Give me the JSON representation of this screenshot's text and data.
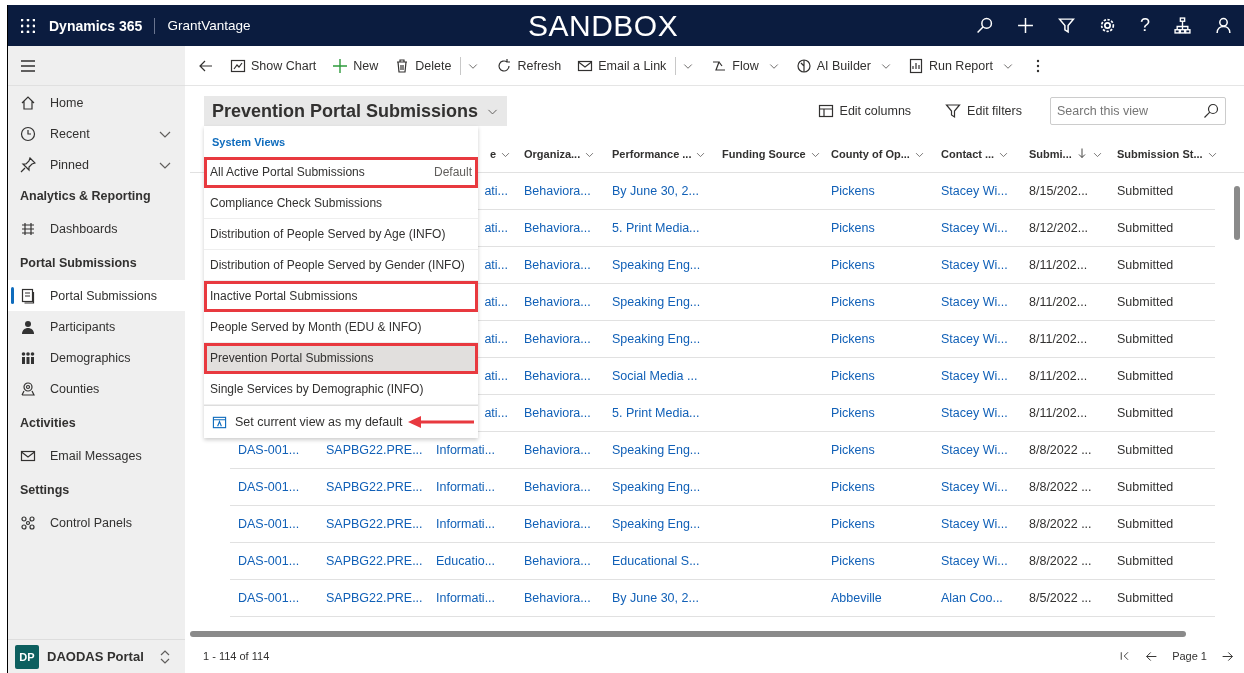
{
  "top_bar": {
    "app_name": "Dynamics 365",
    "org_name": "GrantVantage",
    "environment": "SANDBOX",
    "help_label": "?"
  },
  "toolbar": {
    "items": [
      {
        "kind": "icon"
      },
      {
        "kind": "button",
        "label": "Show Chart"
      },
      {
        "kind": "button",
        "label": "New"
      },
      {
        "kind": "button",
        "label": "Delete"
      },
      {
        "kind": "split"
      },
      {
        "kind": "button",
        "label": "Refresh"
      },
      {
        "kind": "button",
        "label": "Email a Link"
      },
      {
        "kind": "split"
      },
      {
        "kind": "menu",
        "label": "Flow"
      },
      {
        "kind": "menu",
        "label": "AI Builder"
      },
      {
        "kind": "menu",
        "label": "Run Report"
      },
      {
        "kind": "icon"
      }
    ]
  },
  "sidebar": {
    "items": [
      {
        "kind": "item",
        "label": "Home",
        "selected": false
      },
      {
        "kind": "expandable",
        "label": "Recent",
        "selected": false
      },
      {
        "kind": "expandable",
        "label": "Pinned",
        "selected": false
      },
      {
        "kind": "heading",
        "label": "Analytics & Reporting"
      },
      {
        "kind": "item",
        "label": "Dashboards",
        "selected": false
      },
      {
        "kind": "heading",
        "label": "Portal Submissions"
      },
      {
        "kind": "item",
        "label": "Portal Submissions",
        "selected": true
      },
      {
        "kind": "item",
        "label": "Participants",
        "selected": false
      },
      {
        "kind": "item",
        "label": "Demographics",
        "selected": false
      },
      {
        "kind": "item",
        "label": "Counties",
        "selected": false
      },
      {
        "kind": "heading",
        "label": "Activities"
      },
      {
        "kind": "item",
        "label": "Email Messages",
        "selected": false
      },
      {
        "kind": "heading",
        "label": "Settings"
      },
      {
        "kind": "item",
        "label": "Control Panels",
        "selected": false
      }
    ],
    "area_switcher": {
      "initials": "DP",
      "label": "DAODAS Portal"
    }
  },
  "view_selector": {
    "title": "Prevention Portal Submissions",
    "expanded": true,
    "menu": {
      "group": "System Views",
      "items": [
        {
          "label": "All Active Portal Submissions",
          "badge": "Default",
          "selected": false,
          "outlined": true
        },
        {
          "label": "Compliance Check Submissions",
          "selected": false,
          "outlined": false
        },
        {
          "label": "Distribution of People Served by Age (INFO)",
          "selected": false,
          "outlined": false
        },
        {
          "label": "Distribution of People Served by Gender (INFO)",
          "selected": false,
          "outlined": false
        },
        {
          "label": "Inactive Portal Submissions",
          "selected": false,
          "outlined": true
        },
        {
          "label": "People Served by Month (EDU & INFO)",
          "selected": false,
          "outlined": false
        },
        {
          "label": "Prevention Portal Submissions",
          "selected": true,
          "outlined": true
        },
        {
          "label": "Single Services by Demographic (INFO)",
          "selected": false,
          "outlined": false
        }
      ],
      "action": {
        "label": "Set current view as my default",
        "arrow_annotation": true
      }
    }
  },
  "view_actions": {
    "edit_columns": "Edit columns",
    "edit_filters": "Edit filters",
    "search": {
      "placeholder": "Search this view"
    }
  },
  "table": {
    "columns": [
      {
        "kind": "link"
      },
      {
        "kind": "link"
      },
      {
        "label": "e",
        "kind": "link",
        "sort_descending": false
      },
      {
        "label": "Organiza...",
        "kind": "link",
        "sort_descending": false
      },
      {
        "label": "Performance ...",
        "kind": "link",
        "sort_descending": false
      },
      {
        "label": "Funding Source",
        "sort_descending": false
      },
      {
        "label": "County of Op...",
        "kind": "link",
        "sort_descending": false
      },
      {
        "label": "Contact ...",
        "kind": "link",
        "sort_descending": false
      },
      {
        "label": "Submi...",
        "kind": "text",
        "sort_descending": true
      },
      {
        "label": "Submission St...",
        "kind": "text",
        "sort_descending": false
      }
    ],
    "rows": [
      {
        "cells": [
          "",
          "",
          "ati...",
          "Behaviora...",
          "By June 30, 2...",
          "",
          "Pickens",
          "Stacey Wi...",
          "8/15/202...",
          "Submitted"
        ]
      },
      {
        "cells": [
          "",
          "",
          "ati...",
          "Behaviora...",
          "5. Print Media...",
          "",
          "Pickens",
          "Stacey Wi...",
          "8/12/202...",
          "Submitted"
        ]
      },
      {
        "cells": [
          "",
          "",
          "ati...",
          "Behaviora...",
          "Speaking Eng...",
          "",
          "Pickens",
          "Stacey Wi...",
          "8/11/202...",
          "Submitted"
        ]
      },
      {
        "cells": [
          "",
          "",
          "ati...",
          "Behaviora...",
          "Speaking Eng...",
          "",
          "Pickens",
          "Stacey Wi...",
          "8/11/202...",
          "Submitted"
        ]
      },
      {
        "cells": [
          "",
          "",
          "ati...",
          "Behaviora...",
          "Speaking Eng...",
          "",
          "Pickens",
          "Stacey Wi...",
          "8/11/202...",
          "Submitted"
        ]
      },
      {
        "cells": [
          "",
          "",
          "ati...",
          "Behaviora...",
          "Social Media ...",
          "",
          "Pickens",
          "Stacey Wi...",
          "8/11/202...",
          "Submitted"
        ]
      },
      {
        "cells": [
          "",
          "",
          "ati...",
          "Behaviora...",
          "5. Print Media...",
          "",
          "Pickens",
          "Stacey Wi...",
          "8/11/202...",
          "Submitted"
        ]
      },
      {
        "cells": [
          "DAS-001...",
          "SAPBG22.PRE...",
          "Informati...",
          "Behaviora...",
          "Speaking Eng...",
          "",
          "Pickens",
          "Stacey Wi...",
          "8/8/2022 ...",
          "Submitted"
        ]
      },
      {
        "cells": [
          "DAS-001...",
          "SAPBG22.PRE...",
          "Informati...",
          "Behaviora...",
          "Speaking Eng...",
          "",
          "Pickens",
          "Stacey Wi...",
          "8/8/2022 ...",
          "Submitted"
        ]
      },
      {
        "cells": [
          "DAS-001...",
          "SAPBG22.PRE...",
          "Informati...",
          "Behaviora...",
          "Speaking Eng...",
          "",
          "Pickens",
          "Stacey Wi...",
          "8/8/2022 ...",
          "Submitted"
        ]
      },
      {
        "cells": [
          "DAS-001...",
          "SAPBG22.PRE...",
          "Educatio...",
          "Behaviora...",
          "Educational S...",
          "",
          "Pickens",
          "Stacey Wi...",
          "8/8/2022 ...",
          "Submitted"
        ]
      },
      {
        "cells": [
          "DAS-001...",
          "SAPBG22.PRE...",
          "Informati...",
          "Behaviora...",
          "By June 30, 2...",
          "",
          "Abbeville",
          "Alan Coo...",
          "8/5/2022 ...",
          "Submitted"
        ]
      }
    ]
  },
  "footer": {
    "record_count": "1 - 114 of 114",
    "page_label": "Page 1"
  }
}
